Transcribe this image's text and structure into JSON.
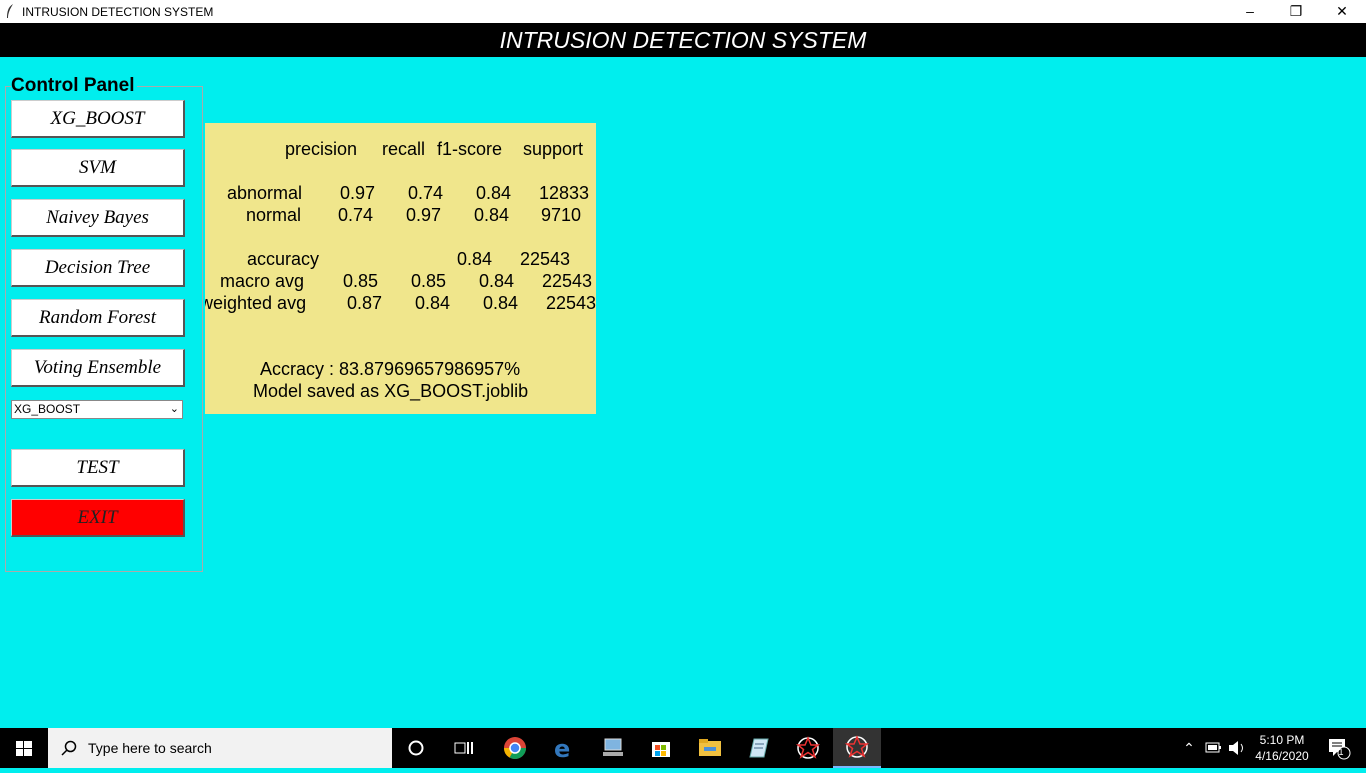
{
  "window": {
    "title": "INTRUSION DETECTION SYSTEM",
    "controls": [
      "–",
      "❐",
      "✕"
    ]
  },
  "banner": {
    "title": "INTRUSION DETECTION SYSTEM"
  },
  "control_panel": {
    "title": "Control Panel",
    "buttons": [
      "XG_BOOST",
      "SVM",
      "Naivey Bayes",
      "Decision Tree",
      "Random Forest",
      "Voting Ensemble"
    ],
    "model_select": {
      "selected": "XG_BOOST"
    },
    "test_label": "TEST",
    "exit_label": "EXIT",
    "exit_color": "#ff0000"
  },
  "report": {
    "header": {
      "precision": "precision",
      "recall": "recall",
      "f1": "f1-score",
      "support": "support"
    },
    "rows": [
      {
        "label": "abnormal",
        "precision": "0.97",
        "recall": "0.74",
        "f1": "0.84",
        "support": "12833"
      },
      {
        "label": "normal",
        "precision": "0.74",
        "recall": "0.97",
        "f1": "0.84",
        "support": "9710"
      }
    ],
    "accuracy": {
      "label": "accuracy",
      "f1": "0.84",
      "support": "22543"
    },
    "macro": {
      "label": "macro avg",
      "precision": "0.85",
      "recall": "0.85",
      "f1": "0.84",
      "support": "22543"
    },
    "weighted": {
      "label": "weighted avg",
      "precision": "0.87",
      "recall": "0.84",
      "f1": "0.84",
      "support": "22543"
    },
    "accuracy_line": "Accracy : 83.87969657986957%",
    "saved_line": "Model saved as XG_BOOST.joblib",
    "background": "#f0e68c"
  },
  "taskbar": {
    "search_placeholder": "Type here to search",
    "time": "5:10 PM",
    "date": "4/16/2020",
    "notification_count": "1",
    "icons": [
      "cortana-icon",
      "task-view-icon",
      "chrome-icon",
      "edge-icon",
      "network-computer-icon",
      "store-icon",
      "file-explorer-icon",
      "notepad-icon",
      "python-app-icon",
      "python-app-active-icon"
    ]
  },
  "colors": {
    "background": "#00eeee",
    "banner": "#000000"
  }
}
